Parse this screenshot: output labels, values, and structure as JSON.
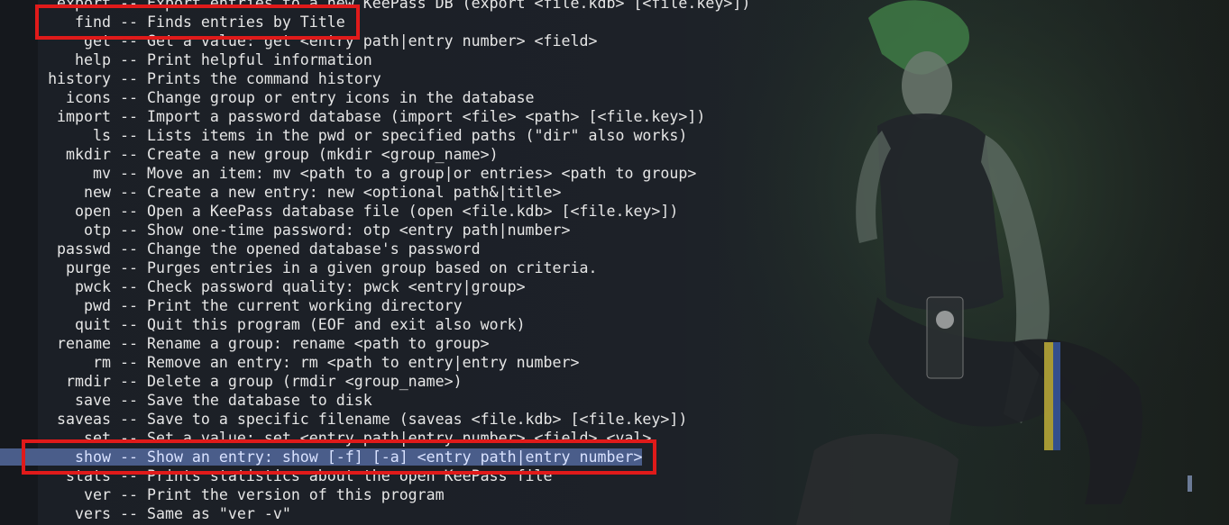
{
  "terminal": {
    "lines": [
      {
        "cmd": "export",
        "desc": "Export entries to a new KeePass DB (export <file.kdb> [<file.key>])"
      },
      {
        "cmd": "find",
        "desc": "Finds entries by Title"
      },
      {
        "cmd": "get",
        "desc": "Get a value: get <entry path|entry number> <field>"
      },
      {
        "cmd": "help",
        "desc": "Print helpful information"
      },
      {
        "cmd": "history",
        "desc": "Prints the command history"
      },
      {
        "cmd": "icons",
        "desc": "Change group or entry icons in the database"
      },
      {
        "cmd": "import",
        "desc": "Import a password database (import <file> <path> [<file.key>])"
      },
      {
        "cmd": "ls",
        "desc": "Lists items in the pwd or specified paths (\"dir\" also works)"
      },
      {
        "cmd": "mkdir",
        "desc": "Create a new group (mkdir <group_name>)"
      },
      {
        "cmd": "mv",
        "desc": "Move an item: mv <path to a group|or entries> <path to group>"
      },
      {
        "cmd": "new",
        "desc": "Create a new entry: new <optional path&|title>"
      },
      {
        "cmd": "open",
        "desc": "Open a KeePass database file (open <file.kdb> [<file.key>])"
      },
      {
        "cmd": "otp",
        "desc": "Show one-time password: otp <entry path|number>"
      },
      {
        "cmd": "passwd",
        "desc": "Change the opened database's password"
      },
      {
        "cmd": "purge",
        "desc": "Purges entries in a given group based on criteria."
      },
      {
        "cmd": "pwck",
        "desc": "Check password quality: pwck <entry|group>"
      },
      {
        "cmd": "pwd",
        "desc": "Print the current working directory"
      },
      {
        "cmd": "quit",
        "desc": "Quit this program (EOF and exit also work)"
      },
      {
        "cmd": "rename",
        "desc": "Rename a group: rename <path to group>"
      },
      {
        "cmd": "rm",
        "desc": "Remove an entry: rm <path to entry|entry number>"
      },
      {
        "cmd": "rmdir",
        "desc": "Delete a group (rmdir <group_name>)"
      },
      {
        "cmd": "save",
        "desc": "Save the database to disk"
      },
      {
        "cmd": "saveas",
        "desc": "Save to a specific filename (saveas <file.kdb> [<file.key>])"
      },
      {
        "cmd": "set",
        "desc": "Set a value: set <entry path|entry number> <field> <val>"
      },
      {
        "cmd": "show",
        "desc": "Show an entry: show [-f] [-a] <entry path|entry number>"
      },
      {
        "cmd": "stats",
        "desc": "Prints statistics about the open KeePass file"
      },
      {
        "cmd": "ver",
        "desc": "Print the version of this program"
      },
      {
        "cmd": "vers",
        "desc": "Same as \"ver -v\""
      }
    ],
    "separator": " -- ",
    "selected_index": 24,
    "highlight_boxes": [
      {
        "target": "find"
      },
      {
        "target": "show"
      }
    ]
  },
  "colors": {
    "text": "#e6e6e6",
    "selection": "#4a5d8a",
    "highlight_box": "#e01a1a",
    "background": "#1b1f26"
  }
}
